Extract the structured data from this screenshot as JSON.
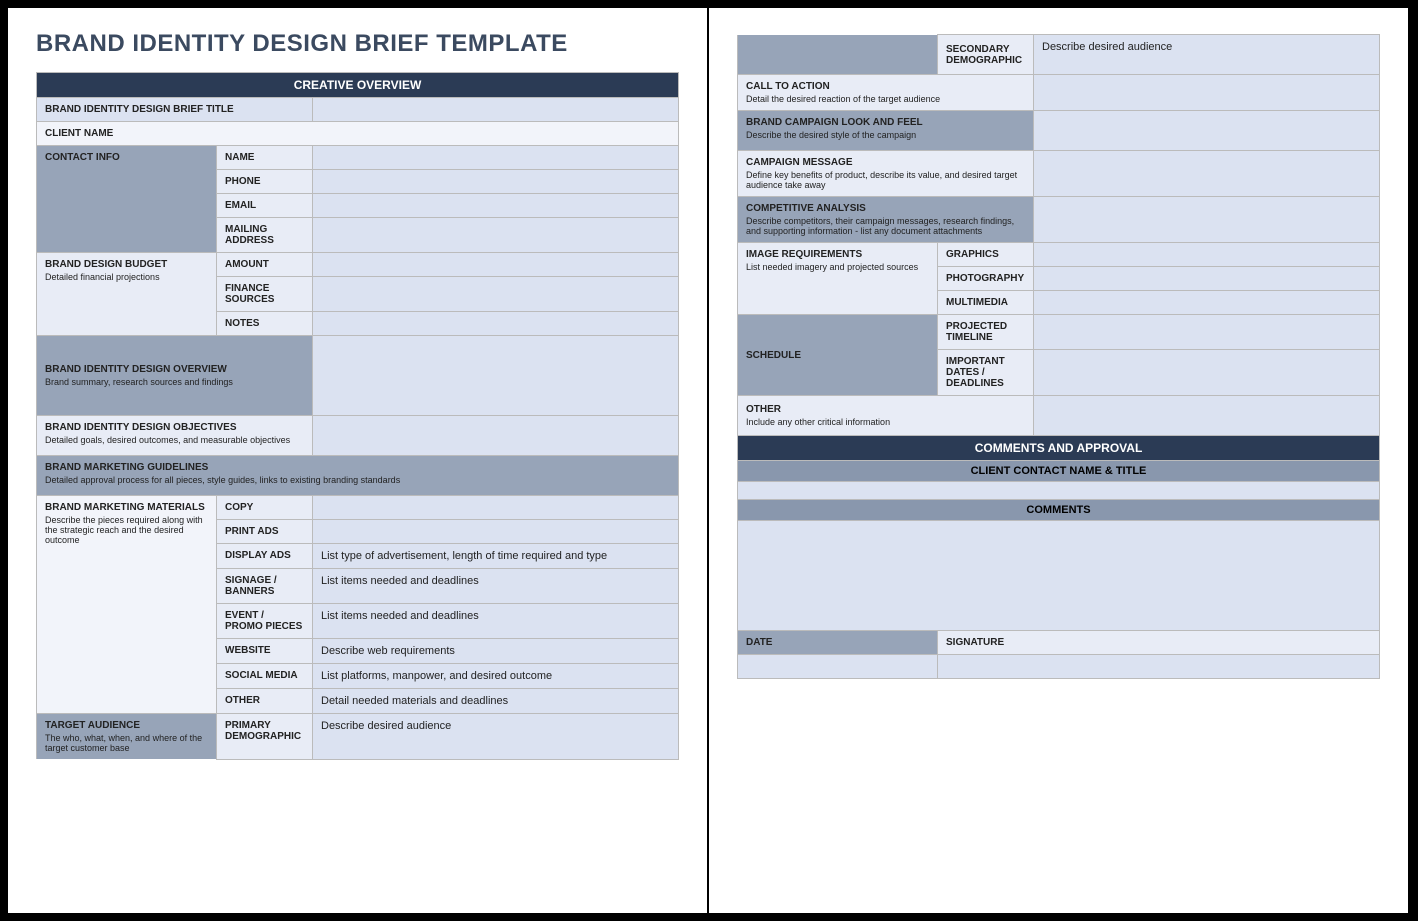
{
  "title": "BRAND IDENTITY DESIGN BRIEF TEMPLATE",
  "sections": {
    "creative_overview": "CREATIVE OVERVIEW",
    "comments_approval": "COMMENTS AND APPROVAL",
    "client_contact_hdr": "CLIENT CONTACT NAME & TITLE",
    "comments_hdr": "COMMENTS"
  },
  "labels": {
    "brief_title": "BRAND IDENTITY DESIGN BRIEF TITLE",
    "client_name": "CLIENT NAME",
    "contact_info": "CONTACT INFO",
    "name": "NAME",
    "phone": "PHONE",
    "email": "EMAIL",
    "mailing_address": "MAILING ADDRESS",
    "budget": "BRAND DESIGN BUDGET",
    "budget_sub": "Detailed financial projections",
    "amount": "AMOUNT",
    "finance_sources": "FINANCE SOURCES",
    "notes": "NOTES",
    "overview": "BRAND IDENTITY DESIGN OVERVIEW",
    "overview_sub": "Brand summary, research sources and findings",
    "objectives": "BRAND IDENTITY DESIGN OBJECTIVES",
    "objectives_sub": "Detailed goals, desired outcomes, and measurable objectives",
    "guidelines": "BRAND MARKETING GUIDELINES",
    "guidelines_sub": "Detailed approval process for all pieces, style guides, links to existing branding standards",
    "materials": "BRAND MARKETING MATERIALS",
    "materials_sub": "Describe the pieces required along with the strategic reach and the desired outcome",
    "copy": "COPY",
    "print_ads": "PRINT ADS",
    "display_ads": "DISPLAY ADS",
    "signage": "SIGNAGE / BANNERS",
    "event": "EVENT / PROMO PIECES",
    "website": "WEBSITE",
    "social": "SOCIAL MEDIA",
    "other_mat": "OTHER",
    "target": "TARGET AUDIENCE",
    "target_sub": "The who, what, when, and where of the target customer base",
    "primary_demo": "PRIMARY DEMOGRAPHIC",
    "secondary_demo": "SECONDARY DEMOGRAPHIC",
    "cta": "CALL TO ACTION",
    "cta_sub": "Detail the desired reaction of the target audience",
    "lookfeel": "BRAND CAMPAIGN LOOK AND FEEL",
    "lookfeel_sub": "Describe the desired style of the campaign",
    "message": "CAMPAIGN MESSAGE",
    "message_sub": "Define key benefits of product, describe its value, and desired target audience take away",
    "competitive": "COMPETITIVE ANALYSIS",
    "competitive_sub": "Describe competitors, their campaign messages, research findings, and supporting information - list any document attachments",
    "img_req": "IMAGE REQUIREMENTS",
    "img_req_sub": "List needed imagery and projected sources",
    "graphics": "GRAPHICS",
    "photography": "PHOTOGRAPHY",
    "multimedia": "MULTIMEDIA",
    "schedule": "SCHEDULE",
    "timeline": "PROJECTED TIMELINE",
    "deadlines": "IMPORTANT DATES / DEADLINES",
    "other": "OTHER",
    "other_sub": "Include any other critical information",
    "date": "DATE",
    "signature": "SIGNATURE"
  },
  "values": {
    "display_ads": "List type of advertisement, length of time required and type",
    "signage": "List items needed and deadlines",
    "event": "List items needed and deadlines",
    "website": "Describe web requirements",
    "social": "List platforms, manpower, and desired outcome",
    "other_mat": "Detail needed materials and deadlines",
    "primary_demo": "Describe desired audience",
    "secondary_demo": "Describe desired audience"
  }
}
